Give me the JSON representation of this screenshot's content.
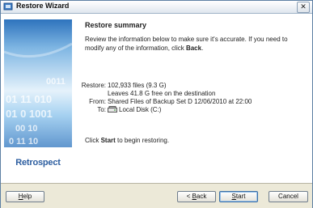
{
  "window": {
    "title": "Restore Wizard",
    "close_label": "✕"
  },
  "banner": {
    "digits": [
      "0011",
      "01 11 010",
      "01 0 1001",
      "00 10",
      "0 11 10"
    ],
    "logo_text": "Retrospect"
  },
  "content": {
    "heading": "Restore summary",
    "intro_pre": "Review the information below to make sure it's accurate. If you need to modify any of the information, click ",
    "intro_back": "Back",
    "intro_post": "."
  },
  "summary": {
    "restore_label": "Restore:",
    "restore_value": "102,933 files (9.3 G)",
    "leaves_value": "Leaves 41.8 G free on the destination",
    "from_label": "From:",
    "from_value": "Shared Files of Backup Set D 12/06/2010 at 22:00",
    "to_label": "To:",
    "to_value": "Local Disk (C:)"
  },
  "footer": {
    "pre": "Click ",
    "start": "Start",
    "post": " to begin restoring."
  },
  "buttons": {
    "help_u": "H",
    "help_rest": "elp",
    "back_pre": "< ",
    "back_u": "B",
    "back_rest": "ack",
    "start_u": "S",
    "start_rest": "tart",
    "cancel": "Cancel"
  }
}
